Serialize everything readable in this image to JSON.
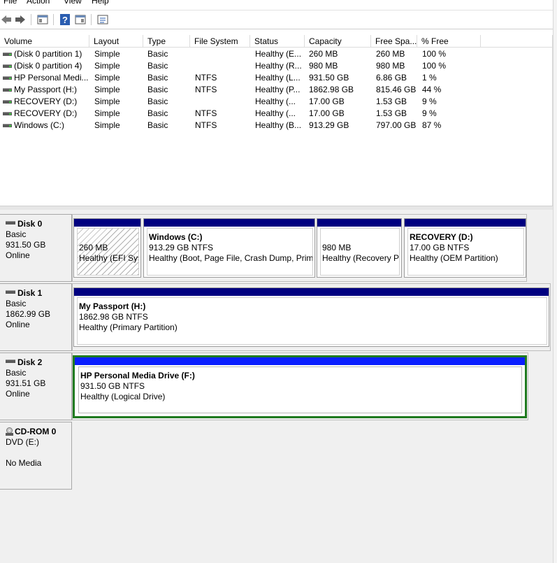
{
  "menu": [
    "File",
    "Action",
    "View",
    "Help"
  ],
  "toolbar": {
    "back_icon": "back-arrow-icon",
    "forward_icon": "forward-arrow-icon",
    "icons": [
      "console-tree-icon",
      "help-icon",
      "properties-icon",
      "settings-list-icon"
    ]
  },
  "volume_list": {
    "columns": [
      "Volume",
      "Layout",
      "Type",
      "File System",
      "Status",
      "Capacity",
      "Free Spa...",
      "% Free"
    ],
    "rows": [
      [
        "(Disk 0 partition 1)",
        "Simple",
        "Basic",
        "",
        "Healthy (E...",
        "260 MB",
        "260 MB",
        "100 %"
      ],
      [
        "(Disk 0 partition 4)",
        "Simple",
        "Basic",
        "",
        "Healthy (R...",
        "980 MB",
        "980 MB",
        "100 %"
      ],
      [
        "HP Personal Medi...",
        "Simple",
        "Basic",
        "NTFS",
        "Healthy (L...",
        "931.50 GB",
        "6.86 GB",
        "1 %"
      ],
      [
        "My Passport (H:)",
        "Simple",
        "Basic",
        "NTFS",
        "Healthy (P...",
        "1862.98 GB",
        "815.46 GB",
        "44 %"
      ],
      [
        "RECOVERY (D:)",
        "Simple",
        "Basic",
        "",
        "Healthy (...",
        "17.00 GB",
        "1.53 GB",
        "9 %"
      ],
      [
        "RECOVERY (D:)",
        "Simple",
        "Basic",
        "NTFS",
        "Healthy (...",
        "17.00 GB",
        "1.53 GB",
        "9 %"
      ],
      [
        "Windows (C:)",
        "Simple",
        "Basic",
        "NTFS",
        "Healthy (B...",
        "913.29 GB",
        "797.00 GB",
        "87 %"
      ]
    ]
  },
  "disks": {
    "disk0": {
      "name": "Disk 0",
      "type": "Basic",
      "size": "931.50 GB",
      "state": "Online",
      "partitions": [
        {
          "title": "",
          "size": "260 MB",
          "status": "Healthy (EFI Syst"
        },
        {
          "title": "Windows  (C:)",
          "size": "913.29 GB NTFS",
          "status": "Healthy (Boot, Page File, Crash Dump, Prima"
        },
        {
          "title": "",
          "size": "980 MB",
          "status": "Healthy (Recovery Pa"
        },
        {
          "title": "RECOVERY  (D:)",
          "size": "17.00 GB NTFS",
          "status": "Healthy (OEM Partition)"
        }
      ]
    },
    "disk1": {
      "name": "Disk 1",
      "type": "Basic",
      "size": "1862.99 GB",
      "state": "Online",
      "partitions": [
        {
          "title": "My Passport  (H:)",
          "size": "1862.98 GB NTFS",
          "status": "Healthy (Primary Partition)"
        }
      ]
    },
    "disk2": {
      "name": "Disk 2",
      "type": "Basic",
      "size": "931.51 GB",
      "state": "Online",
      "partitions": [
        {
          "title": "HP Personal Media Drive  (F:)",
          "size": "931.50 GB NTFS",
          "status": "Healthy (Logical Drive)"
        }
      ]
    },
    "cdrom0": {
      "name": "CD-ROM 0",
      "type": "DVD (E:)",
      "state": "No Media"
    }
  },
  "colors": {
    "primary_bar": "#000080",
    "logical_bar": "#0a1eff",
    "selected_border": "#1f7a1f"
  }
}
